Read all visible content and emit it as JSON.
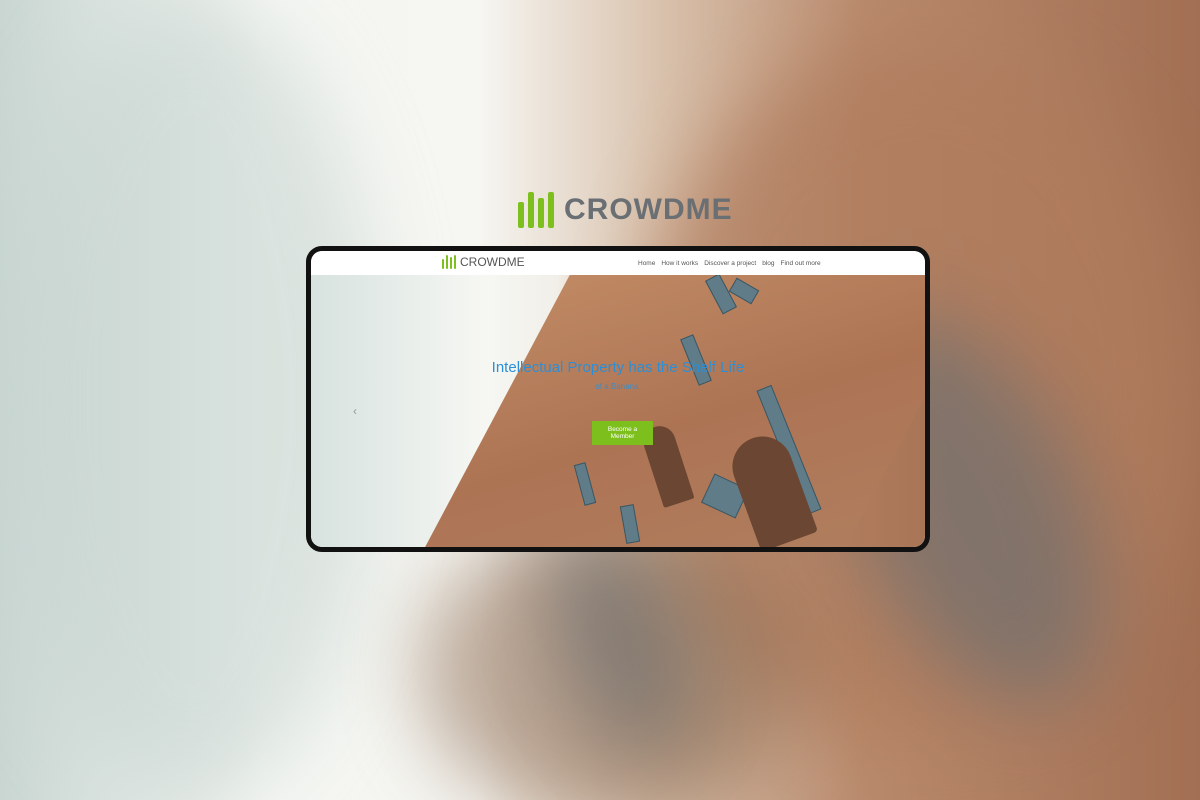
{
  "brand": {
    "name": "CROWDME",
    "accent": "#7dc01e"
  },
  "nav": {
    "items": [
      "Home",
      "How it works",
      "Discover a project",
      "blog",
      "Find out more"
    ]
  },
  "hero": {
    "title": "Intellectual Property has the Shelf Life",
    "subtitle": "of a Banana.",
    "cta": "Become a Member",
    "prev_arrow": "‹"
  }
}
